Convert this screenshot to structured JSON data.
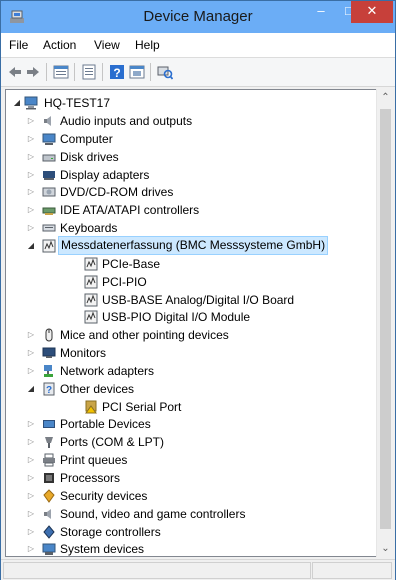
{
  "window": {
    "title": "Device Manager"
  },
  "titlebar": {
    "minimize": "–",
    "maximize": "□",
    "close": "✕"
  },
  "menu": {
    "file": "File",
    "action": "Action",
    "view": "View",
    "help": "Help"
  },
  "toolbar": {
    "icons": [
      "back-icon",
      "forward-icon",
      "properties-icon",
      "show-hidden-icon",
      "help-icon",
      "update-driver-icon",
      "scan-hardware-icon"
    ]
  },
  "tree": {
    "root": "HQ-TEST17",
    "items": [
      {
        "label": "Audio inputs and outputs",
        "state": "collapsed",
        "icon": "speaker-icon"
      },
      {
        "label": "Computer",
        "state": "collapsed",
        "icon": "computer-icon"
      },
      {
        "label": "Disk drives",
        "state": "collapsed",
        "icon": "disk-drive-icon"
      },
      {
        "label": "Display adapters",
        "state": "collapsed",
        "icon": "display-adapter-icon"
      },
      {
        "label": "DVD/CD-ROM drives",
        "state": "collapsed",
        "icon": "dvd-drive-icon"
      },
      {
        "label": "IDE ATA/ATAPI controllers",
        "state": "collapsed",
        "icon": "ide-controller-icon"
      },
      {
        "label": "Keyboards",
        "state": "collapsed",
        "icon": "keyboard-icon"
      },
      {
        "label": "Messdatenerfassung (BMC Messsysteme GmbH)",
        "state": "expanded",
        "icon": "daq-icon",
        "selected": true
      },
      {
        "label": "PCIe-Base",
        "child": true,
        "icon": "daq-icon"
      },
      {
        "label": "PCI-PIO",
        "child": true,
        "icon": "daq-icon"
      },
      {
        "label": "USB-BASE Analog/Digital I/O Board",
        "child": true,
        "icon": "daq-icon"
      },
      {
        "label": "USB-PIO Digital I/O Module",
        "child": true,
        "icon": "daq-icon"
      },
      {
        "label": "Mice and other pointing devices",
        "state": "collapsed",
        "icon": "mouse-icon"
      },
      {
        "label": "Monitors",
        "state": "collapsed",
        "icon": "monitor-icon"
      },
      {
        "label": "Network adapters",
        "state": "collapsed",
        "icon": "network-icon"
      },
      {
        "label": "Other devices",
        "state": "expanded",
        "icon": "other-devices-icon"
      },
      {
        "label": "PCI Serial Port",
        "child": true,
        "icon": "warning-device-icon"
      },
      {
        "label": "Portable Devices",
        "state": "collapsed",
        "icon": "portable-device-icon"
      },
      {
        "label": "Ports (COM & LPT)",
        "state": "collapsed",
        "icon": "port-icon"
      },
      {
        "label": "Print queues",
        "state": "collapsed",
        "icon": "printer-icon"
      },
      {
        "label": "Processors",
        "state": "collapsed",
        "icon": "processor-icon"
      },
      {
        "label": "Security devices",
        "state": "collapsed",
        "icon": "security-icon"
      },
      {
        "label": "Sound, video and game controllers",
        "state": "collapsed",
        "icon": "sound-icon"
      },
      {
        "label": "Storage controllers",
        "state": "collapsed",
        "icon": "storage-icon"
      },
      {
        "label": "System devices",
        "state": "collapsed",
        "icon": "system-icon"
      }
    ]
  },
  "colors": {
    "titlebar": "#6badf6",
    "close": "#c7403a",
    "selection": "#cce8ff"
  }
}
